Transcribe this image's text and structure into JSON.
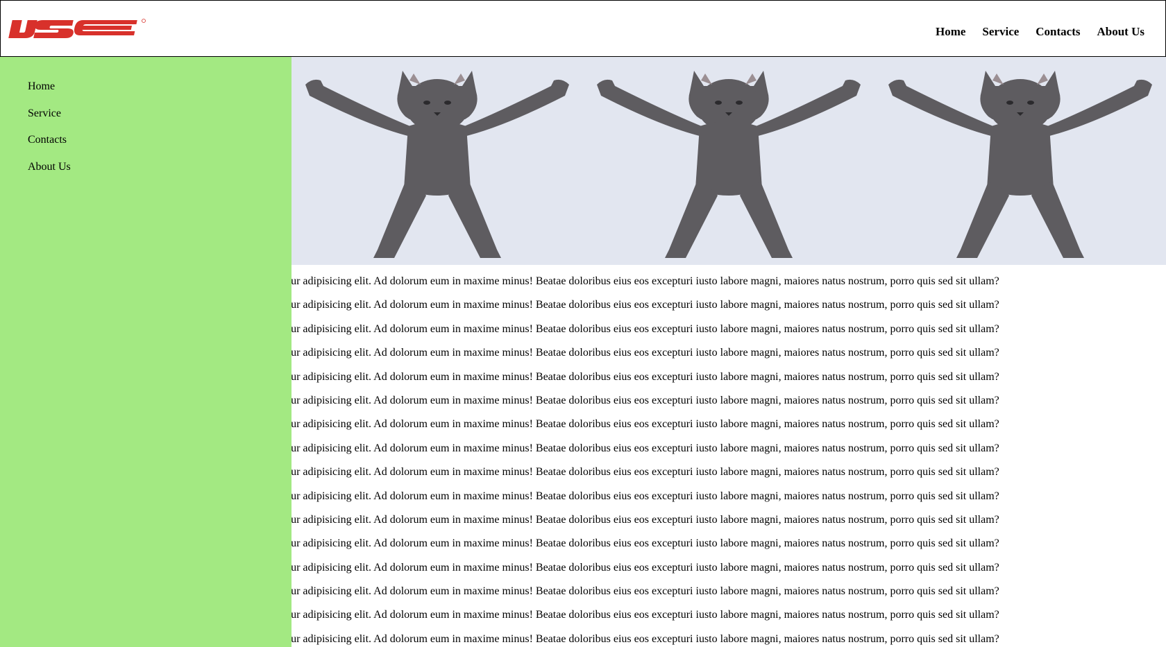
{
  "header": {
    "logo_text": "IJSE",
    "nav": [
      "Home",
      "Service",
      "Contacts",
      "About Us"
    ]
  },
  "sidebar": {
    "items": [
      "Home",
      "Service",
      "Contacts",
      "About Us"
    ]
  },
  "banner": {
    "image_alt": "dancing cat",
    "repeat": 3
  },
  "content": {
    "lines": [
      "r sit amet, consectetur adipisicing elit. Ad dolorum eum in maxime minus! Beatae doloribus eius eos excepturi iusto labore magni, maiores natus nostrum, porro quis sed sit ullam?",
      "r sit amet, consectetur adipisicing elit. Ad dolorum eum in maxime minus! Beatae doloribus eius eos excepturi iusto labore magni, maiores natus nostrum, porro quis sed sit ullam?",
      "r sit amet, consectetur adipisicing elit. Ad dolorum eum in maxime minus! Beatae doloribus eius eos excepturi iusto labore magni, maiores natus nostrum, porro quis sed sit ullam?",
      "r sit amet, consectetur adipisicing elit. Ad dolorum eum in maxime minus! Beatae doloribus eius eos excepturi iusto labore magni, maiores natus nostrum, porro quis sed sit ullam?",
      "r sit amet, consectetur adipisicing elit. Ad dolorum eum in maxime minus! Beatae doloribus eius eos excepturi iusto labore magni, maiores natus nostrum, porro quis sed sit ullam?",
      "r sit amet, consectetur adipisicing elit. Ad dolorum eum in maxime minus! Beatae doloribus eius eos excepturi iusto labore magni, maiores natus nostrum, porro quis sed sit ullam?",
      "r sit amet, consectetur adipisicing elit. Ad dolorum eum in maxime minus! Beatae doloribus eius eos excepturi iusto labore magni, maiores natus nostrum, porro quis sed sit ullam?",
      "r sit amet, consectetur adipisicing elit. Ad dolorum eum in maxime minus! Beatae doloribus eius eos excepturi iusto labore magni, maiores natus nostrum, porro quis sed sit ullam?",
      "r sit amet, consectetur adipisicing elit. Ad dolorum eum in maxime minus! Beatae doloribus eius eos excepturi iusto labore magni, maiores natus nostrum, porro quis sed sit ullam?",
      "r sit amet, consectetur adipisicing elit. Ad dolorum eum in maxime minus! Beatae doloribus eius eos excepturi iusto labore magni, maiores natus nostrum, porro quis sed sit ullam?",
      "r sit amet, consectetur adipisicing elit. Ad dolorum eum in maxime minus! Beatae doloribus eius eos excepturi iusto labore magni, maiores natus nostrum, porro quis sed sit ullam?",
      "r sit amet, consectetur adipisicing elit. Ad dolorum eum in maxime minus! Beatae doloribus eius eos excepturi iusto labore magni, maiores natus nostrum, porro quis sed sit ullam?",
      "r sit amet, consectetur adipisicing elit. Ad dolorum eum in maxime minus! Beatae doloribus eius eos excepturi iusto labore magni, maiores natus nostrum, porro quis sed sit ullam?",
      "r sit amet, consectetur adipisicing elit. Ad dolorum eum in maxime minus! Beatae doloribus eius eos excepturi iusto labore magni, maiores natus nostrum, porro quis sed sit ullam?",
      "r sit amet, consectetur adipisicing elit. Ad dolorum eum in maxime minus! Beatae doloribus eius eos excepturi iusto labore magni, maiores natus nostrum, porro quis sed sit ullam?",
      "r sit amet, consectetur adipisicing elit. Ad dolorum eum in maxime minus! Beatae doloribus eius eos excepturi iusto labore magni, maiores natus nostrum, porro quis sed sit ullam?"
    ]
  },
  "colors": {
    "logo_red": "#d8312b",
    "sidebar_bg": "#a3e982",
    "banner_bg": "#e2e6f0",
    "cat_fur": "#5e5c60"
  }
}
